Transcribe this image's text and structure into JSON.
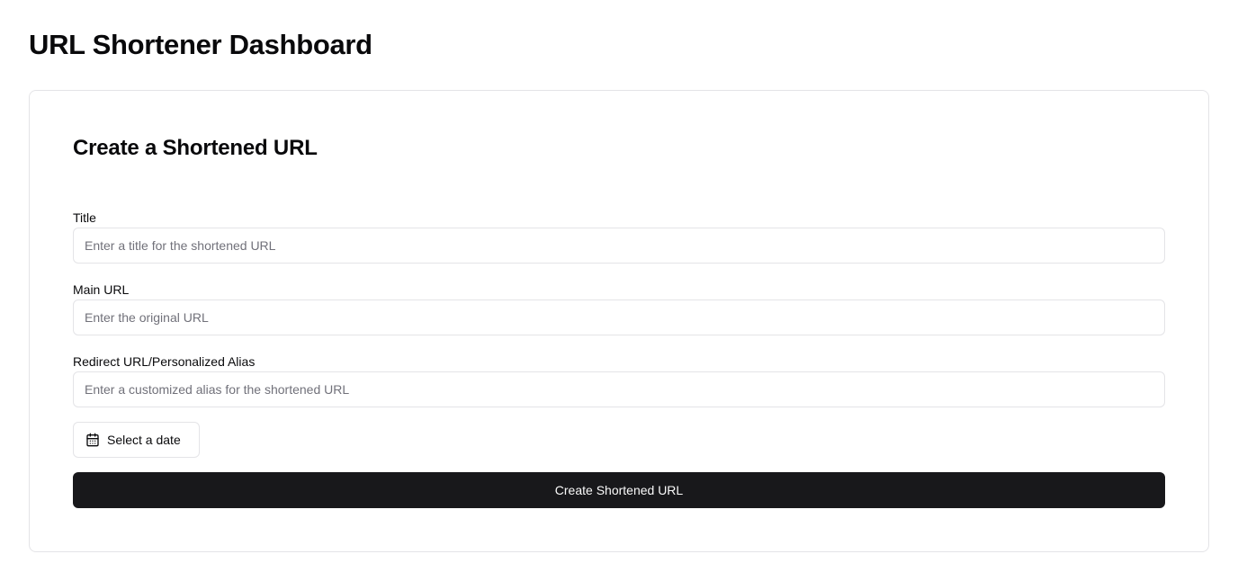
{
  "header": {
    "title": "URL Shortener Dashboard"
  },
  "form": {
    "heading": "Create a Shortened URL",
    "title_field": {
      "label": "Title",
      "placeholder": "Enter a title for the shortened URL",
      "value": ""
    },
    "main_url_field": {
      "label": "Main URL",
      "placeholder": "Enter the original URL",
      "value": ""
    },
    "alias_field": {
      "label": "Redirect URL/Personalized Alias",
      "placeholder": "Enter a customized alias for the shortened URL",
      "value": ""
    },
    "date_picker": {
      "label": "Select a date",
      "icon": "calendar-icon"
    },
    "submit_label": "Create Shortened URL"
  },
  "colors": {
    "primary_button": "#18181b",
    "primary_button_text": "#fafafa",
    "border": "#e4e4e7",
    "placeholder": "#71717a"
  }
}
